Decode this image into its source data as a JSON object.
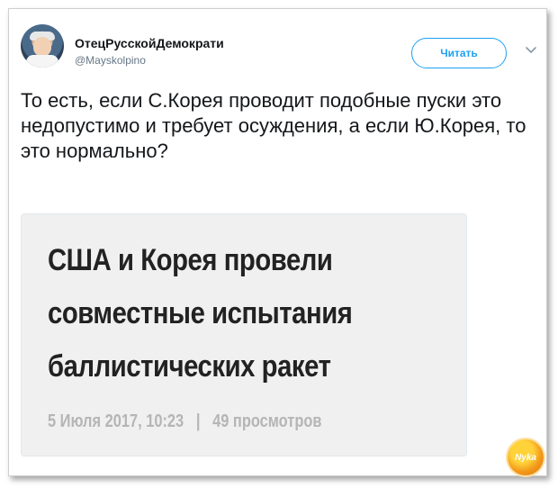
{
  "tweet": {
    "author_name": "ОтецРусскойДемократи",
    "author_handle": "@Mayskolpino",
    "follow_label": "Читать",
    "text": "То есть, если С.Корея проводит подобные пуски это недопустимо и требует осуждения, а если Ю.Корея, то это нормально?"
  },
  "embed": {
    "headline": "США и Корея провели совместные испытания баллистических ракет",
    "date": "5 Июля 2017, 10:23",
    "separator": "|",
    "views": "49 просмотров"
  },
  "watermark": {
    "text": "Nyka"
  },
  "colors": {
    "accent": "#1da1f2",
    "text_primary": "#14171a",
    "text_secondary": "#657786",
    "embed_bg": "#f0f0f0",
    "embed_meta": "#b5b5b5"
  },
  "icons": {
    "avatar": "user-avatar",
    "menu": "chevron-down-icon",
    "watermark": "site-logo"
  }
}
